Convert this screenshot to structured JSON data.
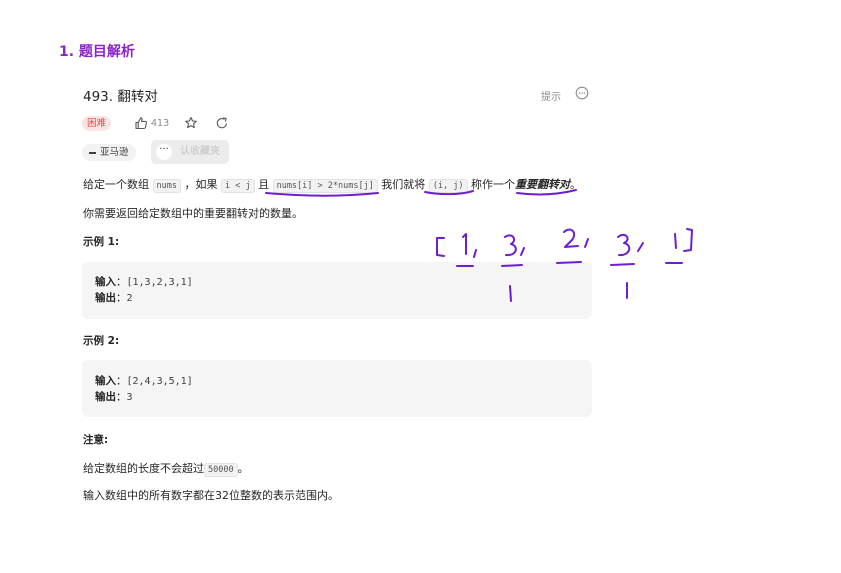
{
  "section": {
    "title": "1. 题目解析"
  },
  "problem": {
    "title": "493. 翻转对",
    "hint_label": "提示",
    "difficulty": "困难",
    "likes": "413",
    "company_tag": "亚马逊",
    "tooltip_dots": "···",
    "tooltip_text": "认收藏夹"
  },
  "description": {
    "p1": {
      "t1": "给定一个数组 ",
      "c1": "nums",
      "t2": " ，如果 ",
      "c2": "i < j",
      "t3": " 且 ",
      "c3": "nums[i] > 2*nums[j]",
      "t4": " 我们就将 ",
      "c4": "(i, j)",
      "t5": " 称作一个",
      "em": "重要翻转对",
      "t6": "。"
    },
    "p2": "你需要返回给定数组中的重要翻转对的数量。"
  },
  "examples": [
    {
      "heading": "示例 1:",
      "input_label": "输入",
      "input_value": "[1,3,2,3,1]",
      "output_label": "输出",
      "output_value": "2"
    },
    {
      "heading": "示例 2:",
      "input_label": "输入",
      "input_value": "[2,4,3,5,1]",
      "output_label": "输出",
      "output_value": "3"
    }
  ],
  "note": {
    "heading": "注意:",
    "line1_before": "给定数组的长度不会超过",
    "line1_code": "50000",
    "line1_after": "。",
    "line2": "输入数组中的所有数字都在32位整数的表示范围内。"
  },
  "colors": {
    "accent_purple": "#8a23c8",
    "ink_purple": "#6d1fd0",
    "hard_red": "#ef4743"
  }
}
